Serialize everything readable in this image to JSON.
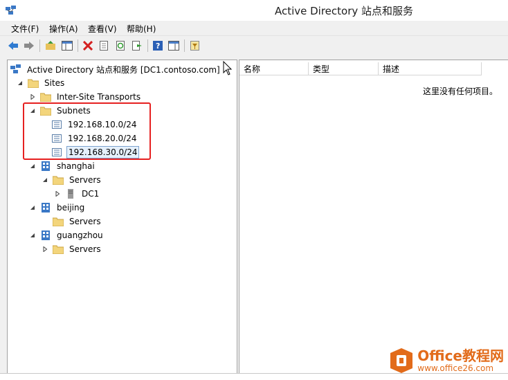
{
  "window": {
    "title": "Active Directory 站点和服务"
  },
  "menu": [
    "文件(F)",
    "操作(A)",
    "查看(V)",
    "帮助(H)"
  ],
  "toolbar": {
    "icons": [
      "back-arrow-icon",
      "forward-arrow-icon",
      "up-folder-icon",
      "show-hide-tree-icon",
      "delete-icon",
      "properties-icon",
      "refresh-icon",
      "export-list-icon",
      "help-icon",
      "action-pane-icon",
      "filter-icon"
    ]
  },
  "tree": {
    "root": "Active Directory 站点和服务 [DC1.contoso.com]",
    "sites": "Sites",
    "inter_site": "Inter-Site Transports",
    "subnets": "Subnets",
    "subnet_items": [
      "192.168.10.0/24",
      "192.168.20.0/24",
      "192.168.30.0/24"
    ],
    "shanghai": "shanghai",
    "shanghai_servers": "Servers",
    "dc1": "DC1",
    "beijing": "beijing",
    "beijing_servers": "Servers",
    "guangzhou": "guangzhou",
    "guangzhou_servers": "Servers"
  },
  "list": {
    "columns": [
      "名称",
      "类型",
      "描述"
    ],
    "empty_message": "这里没有任何项目。"
  },
  "watermark": {
    "line1": "Office教程网",
    "line2": "www.office26.com"
  },
  "colors": {
    "highlight_box": "#e62020",
    "selection": "#e5f0fb",
    "watermark": "#e26b1a"
  }
}
